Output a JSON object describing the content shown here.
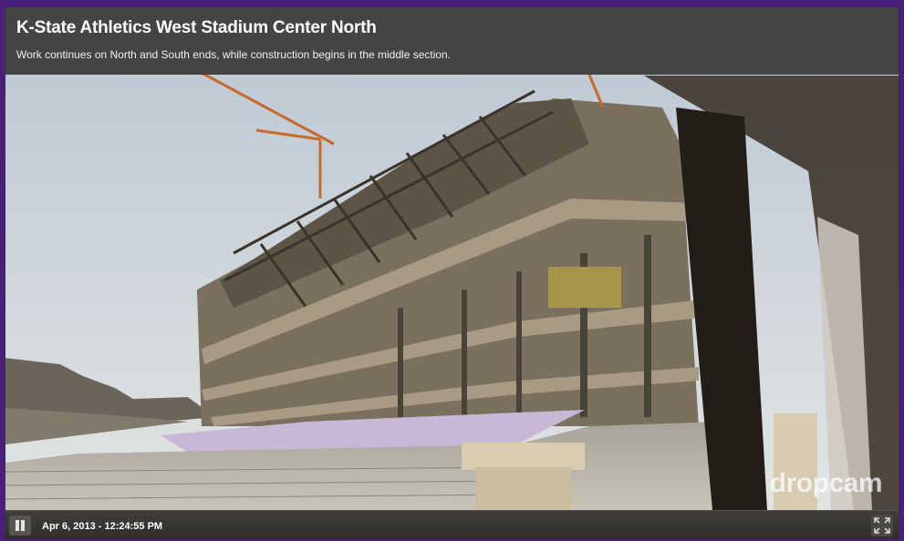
{
  "header": {
    "title": "K-State Athletics West Stadium Center North",
    "subtitle": "Work continues on North and South ends, while construction begins in the middle section."
  },
  "video": {
    "watermark": "dropcam"
  },
  "controls": {
    "timestamp": "Apr 6, 2013 - 12:24:55 PM",
    "pause_icon": "pause-icon",
    "fullscreen_icon": "fullscreen-icon"
  },
  "colors": {
    "frame": "#4a1f7a",
    "title_bar": "#3a3835",
    "control_bar": "#2e2d2b"
  }
}
